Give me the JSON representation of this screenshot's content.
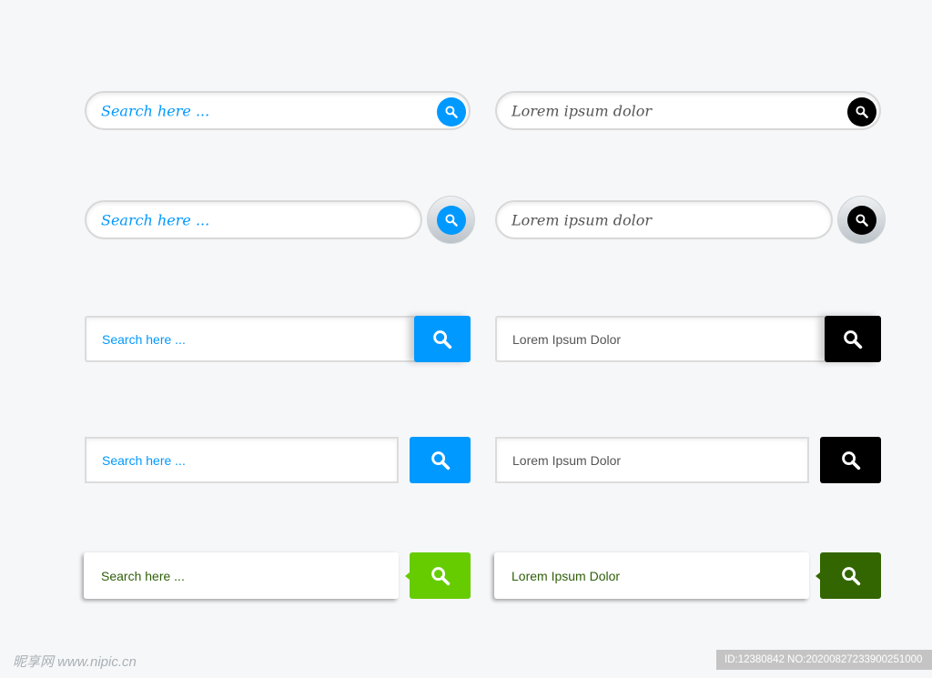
{
  "colors": {
    "blue": "#0099ff",
    "black": "#000000",
    "lightgreen": "#66cc00",
    "darkgreen": "#336600",
    "green_text": "#2f5f0a"
  },
  "left": {
    "serif_placeholder": "Search here ...",
    "sans_placeholder": "Search here ..."
  },
  "right": {
    "serif_placeholder": "Lorem ipsum dolor",
    "sans_placeholder": "Lorem Ipsum Dolor"
  },
  "icon": "search-icon",
  "watermark": {
    "logo": "昵享网 www.nipic.cn",
    "id": "ID:12380842 NO:20200827233900251000"
  }
}
